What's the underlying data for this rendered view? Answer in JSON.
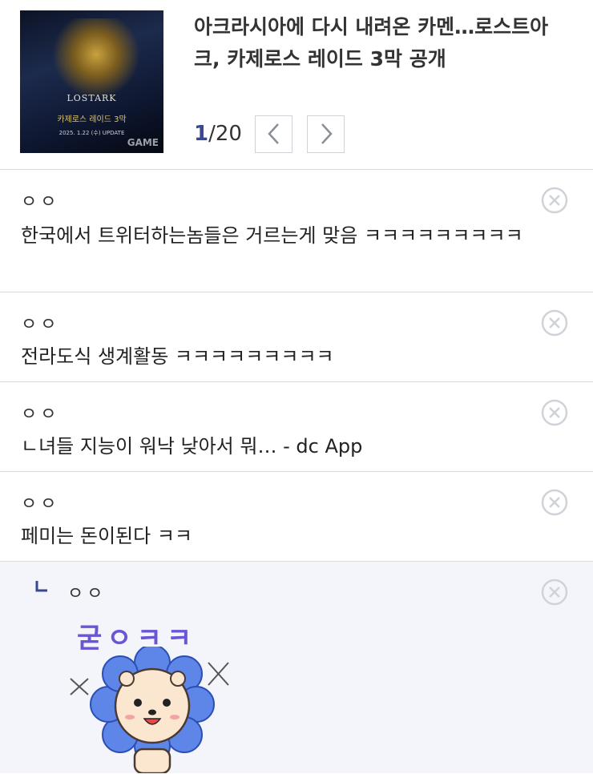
{
  "post": {
    "title": "아크라시아에 다시 내려온 카멘…로스트아크, 카제로스 레이드 3막 공개",
    "pager_current": "1",
    "pager_total": "/20",
    "thumbnail": {
      "brand": "LOSTARK",
      "subtitle": "카제로스 레이드 3막",
      "caption": "2025. 1.22 (수) UPDATE",
      "stamp": "GAME"
    }
  },
  "comments": [
    {
      "nick": "ㅇㅇ",
      "text": "한국에서 트위터하는놈들은 거르는게 맞음 ㅋㅋㅋㅋㅋㅋㅋㅋㅋ"
    },
    {
      "nick": "ㅇㅇ",
      "text": "전라도식 생계활동 ㅋㅋㅋㅋㅋㅋㅋㅋㅋ"
    },
    {
      "nick": "ㅇㅇ",
      "text": "ㄴ녀들 지능이 워낙 낮아서 뭐… - dc App"
    },
    {
      "nick": "ㅇㅇ",
      "text": "페미는 돈이된다 ㅋㅋ"
    }
  ],
  "reply": {
    "nick": "ㅇㅇ",
    "sticker_text": "굳ㅇㅋㅋ"
  },
  "icons": {
    "delete": "close-circle-icon",
    "prev": "chevron-left-icon",
    "next": "chevron-right-icon",
    "reply": "reply-arrow-icon"
  },
  "colors": {
    "accent": "#3b4890",
    "reply_bg": "#f3f5fb",
    "divider": "#d9d9d9"
  }
}
